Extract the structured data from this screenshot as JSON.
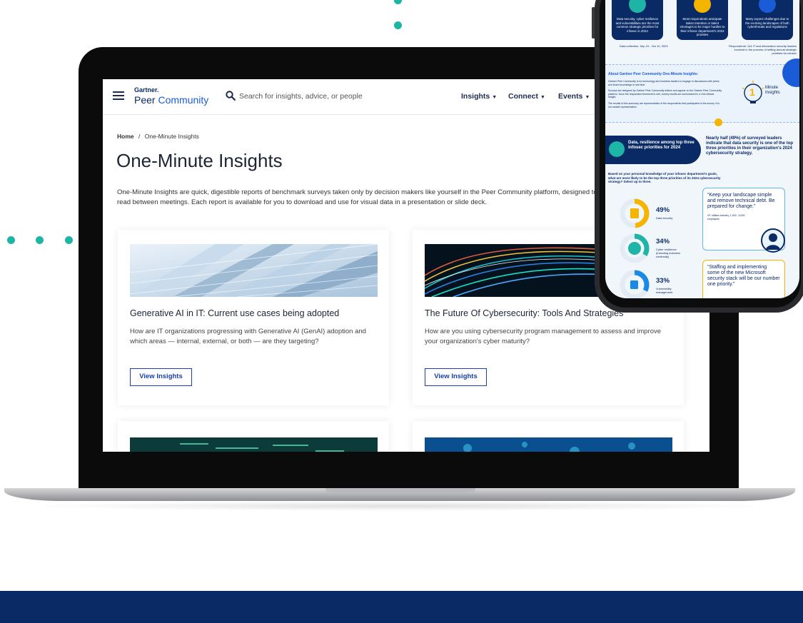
{
  "site": {
    "logo_top": "Gartner.",
    "logo_peer": "Peer",
    "logo_community": "Community",
    "search_placeholder": "Search for insights, advice, or people",
    "nav": [
      "Insights",
      "Connect",
      "Events"
    ]
  },
  "breadcrumb": {
    "home": "Home",
    "separator": "/",
    "current": "One-Minute Insights"
  },
  "page": {
    "title": "One-Minute Insights",
    "description": "One-Minute Insights are quick, digestible reports of benchmark surveys taken only by decision makers like yourself in the Peer Community platform, designed to be read between meetings. Each report is available for you to download and use for visual data in a presentation or slide deck."
  },
  "cards": [
    {
      "title": "Generative AI in IT: Current use cases being adopted",
      "description": "How are IT organizations progressing with Generative AI (GenAI) adoption and which areas — internal, external, or both — are they targeting?",
      "button": "View Insights"
    },
    {
      "title": "The Future Of Cybersecurity: Tools And Strategies",
      "description": "How are you using cybersecurity program management to assess and improve your organization's cyber maturity?",
      "button": "View Insights"
    }
  ],
  "phone": {
    "tiles": [
      "Data security, cyber resilience and vulnerabilities are the most common strategic priorities for infosec in 2024",
      "Most respondents anticipate talent retention or talent shortages to be major hurdles to their infosec department's 2024 priorities",
      "Many expect challenges due to the evolving landscapes of both cyberthreats and regulations"
    ],
    "data_collection": "Data collection: Sep 24 - Oct 10, 2023",
    "respondents": "Respondents: 144 IT and information security leaders involved in the process of setting annual strategic priorities for infosec",
    "about_title": "About Gartner Peer Community One-Minute Insights:",
    "about_p1": "Gartner Peer Community is for technology and business leaders to engage in discussions with peers and share knowledge in real time.",
    "about_p2": "Surveys are designed by Gartner Peer Community editors and appear on the Gartner Peer Community platform. Once the respondent threshold is met, survey results are summarized in a One-Minute Insight.",
    "about_p3": "The results of this summary are representative of the respondents that participated in the survey. It is not market representative.",
    "badge_number": "1",
    "badge_text_1": "Minute",
    "badge_text_2": "Insights",
    "pill": "Data, resilience among top three infosec priorities for 2024",
    "lead": "Nearly half (49%) of surveyed leaders indicate that data security is one of the top three priorities in their organization's 2024 cybersecurity strategy.",
    "question": "Based on your personal knowledge of your infosec department's goals, what are most likely to be the top three priorities of its 2024 cybersecurity strategy? Select up to three.",
    "stats": [
      {
        "pct": "49%",
        "label": "Data security",
        "color": "#f5b400",
        "fill": 0.49
      },
      {
        "pct": "34%",
        "label": "Cyber resilience (including business continuity)",
        "color": "#1fb5a6",
        "fill": 0.34
      },
      {
        "pct": "33%",
        "label": "Vulnerability management",
        "color": "#1a8ae6",
        "fill": 0.33
      }
    ],
    "quote1": "“Keep your landscape simple and remove technical debt. Be prepared for change.”",
    "quote1_attr": "VP, utilities industry, 1,000 - 5,000 employees",
    "quote2": "“Staffing and implementing some of the new Microsoft security stack will be our number one priority.”"
  },
  "colors": {
    "teal": "#1fb5a6",
    "navy": "#0a2a66",
    "link_blue": "#1a3fae",
    "gold": "#f5b400"
  }
}
